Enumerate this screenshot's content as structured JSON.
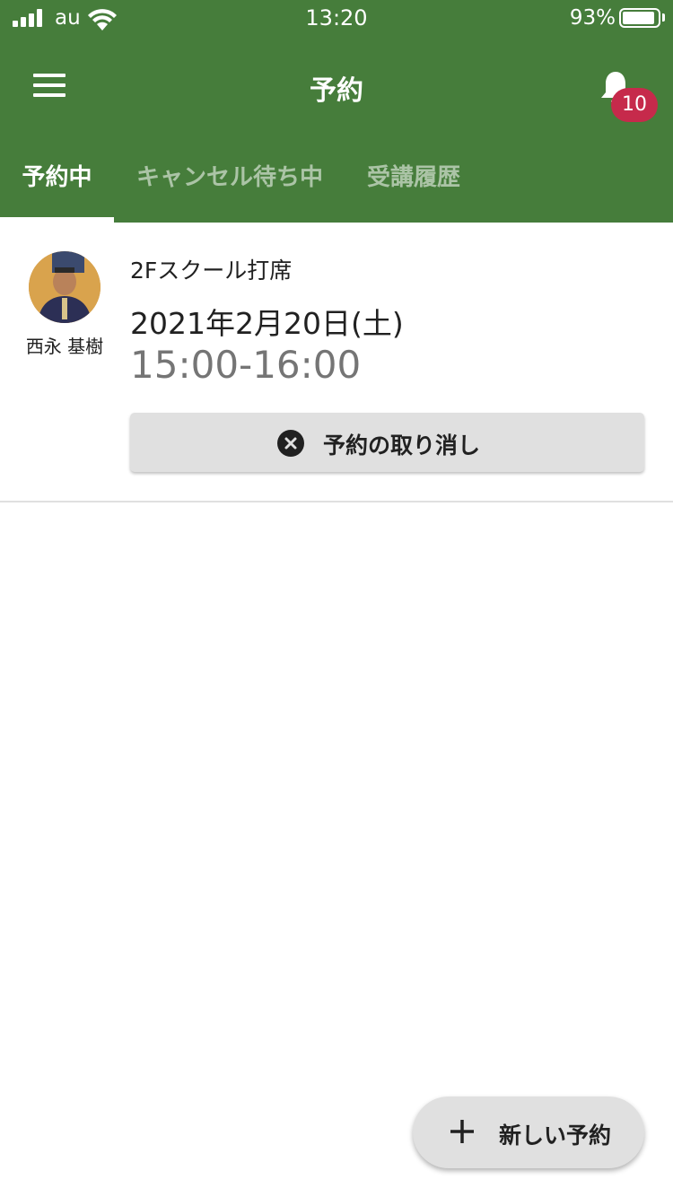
{
  "status_bar": {
    "carrier": "au",
    "time": "13:20",
    "battery_percent": "93%",
    "battery_level": 0.93
  },
  "app_bar": {
    "title": "予約",
    "menu_icon": "hamburger-menu-icon",
    "notification_icon": "bell-icon",
    "notification_count": "10"
  },
  "tabs": [
    {
      "label": "予約中",
      "active": true
    },
    {
      "label": "キャンセル待ち中",
      "active": false
    },
    {
      "label": "受講履歴",
      "active": false
    }
  ],
  "reservation": {
    "coach_name": "西永 基樹",
    "lesson_name": "2Fスクール打席",
    "date": "2021年2月20日(土)",
    "time": "15:00-16:00",
    "cancel_label": "予約の取り消し",
    "cancel_icon": "close-circle-icon"
  },
  "fab": {
    "label": "新しい予約",
    "icon": "plus-icon"
  },
  "colors": {
    "primary": "#467d3b",
    "badge": "#c62a4b",
    "button_bg": "#e0e0e0"
  }
}
